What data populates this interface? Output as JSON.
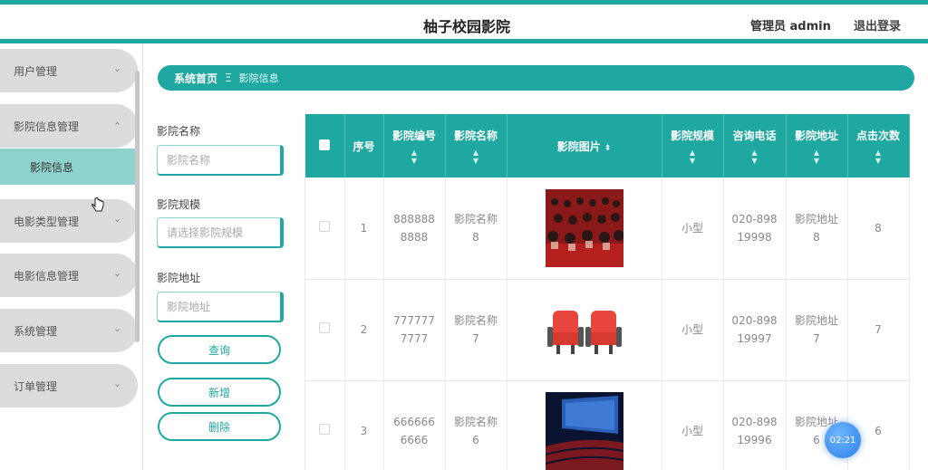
{
  "header": {
    "title": "柚子校园影院",
    "admin": "管理员 admin",
    "logout": "退出登录"
  },
  "sidebar": {
    "items": [
      {
        "label": "用户管理",
        "chevron": "⌄"
      },
      {
        "label": "影院信息管理",
        "chevron": "⌃"
      },
      {
        "label": "电影类型管理",
        "chevron": "⌄"
      },
      {
        "label": "电影信息管理",
        "chevron": "⌄"
      },
      {
        "label": "系统管理",
        "chevron": "⌄"
      },
      {
        "label": "订单管理",
        "chevron": "⌄"
      }
    ],
    "active_sub": "影院信息"
  },
  "breadcrumb": {
    "home": "系统首页",
    "sep": "Ξ",
    "current": "影院信息"
  },
  "search": {
    "name_label": "影院名称",
    "name_placeholder": "影院名称",
    "scale_label": "影院规模",
    "scale_placeholder": "请选择影院规模",
    "address_label": "影院地址",
    "address_placeholder": "影院地址",
    "query_button": "查询",
    "add_button": "新增",
    "delete_button": "删除"
  },
  "table": {
    "headers": [
      "序号",
      "影院编号",
      "影院名称",
      "影院图片",
      "影院规模",
      "咨询电话",
      "影院地址",
      "点击次数"
    ],
    "rows": [
      {
        "index": "1",
        "code": "8888888888",
        "name": "影院名称8",
        "image": "theater-audience-photo",
        "scale": "小型",
        "phone": "020-89819998",
        "address": "影院地址8",
        "clicks": "8"
      },
      {
        "index": "2",
        "code": "7777777777",
        "name": "影院名称7",
        "image": "red-seats-icon",
        "scale": "小型",
        "phone": "020-89819997",
        "address": "影院地址7",
        "clicks": "7"
      },
      {
        "index": "3",
        "code": "6666666666",
        "name": "影院名称6",
        "image": "dark-cinema-hall-photo",
        "scale": "小型",
        "phone": "020-89819996",
        "address": "影院地址6",
        "clicks": "6"
      }
    ]
  },
  "timer": "02:21",
  "colors": {
    "accent": "#1fa8a1",
    "submenu": "#8fd1cc",
    "pill": "#dcdcdc"
  }
}
